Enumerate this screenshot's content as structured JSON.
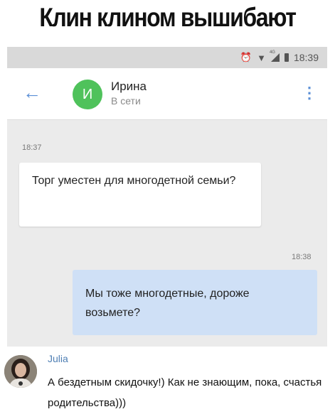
{
  "meme": {
    "title": "Клин клином вышибают"
  },
  "status_bar": {
    "time": "18:39",
    "network_label": "4G",
    "icons": [
      "alarm-icon",
      "wifi-icon",
      "signal-icon",
      "battery-icon"
    ]
  },
  "chat_header": {
    "contact_name": "Ирина",
    "contact_status": "В сети",
    "avatar_letter": "И",
    "avatar_color": "#4fc25b",
    "accent_color": "#5b8fd6"
  },
  "messages": [
    {
      "direction": "incoming",
      "time": "18:37",
      "text": "Торг уместен для многодетной семьи?"
    },
    {
      "direction": "outgoing",
      "time": "18:38",
      "text": "Мы тоже многодетные, дороже возьмете?"
    }
  ],
  "comment": {
    "author": "Julia",
    "text": "А бездетным скидочку!) Как не знающим, пока, счастья родительства)))"
  }
}
